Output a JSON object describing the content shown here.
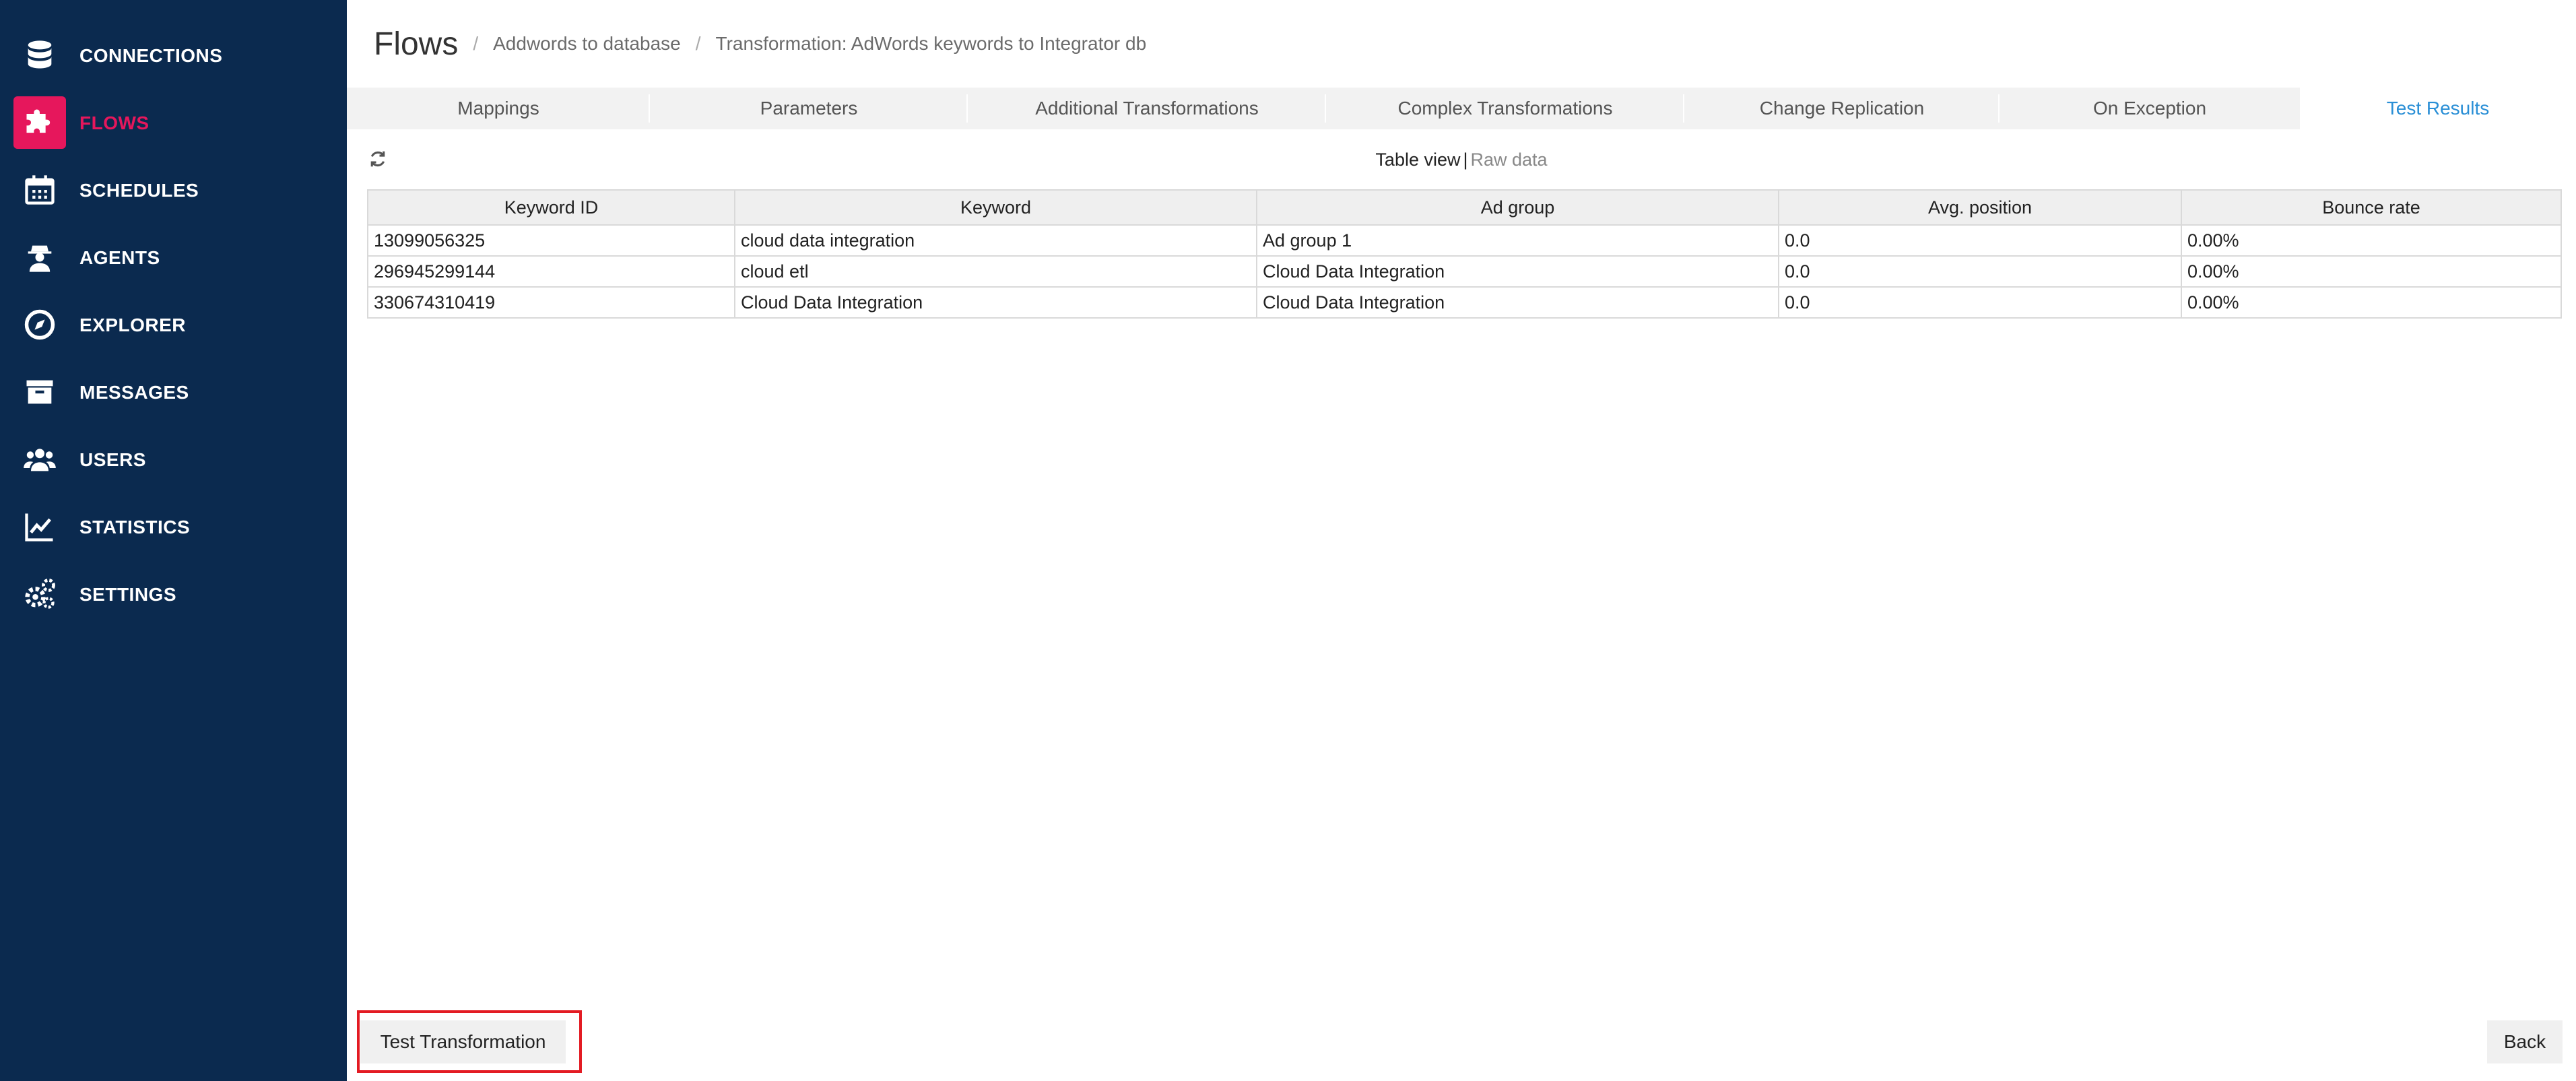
{
  "sidebar": {
    "items": [
      {
        "label": "CONNECTIONS",
        "icon": "database-icon"
      },
      {
        "label": "FLOWS",
        "icon": "puzzle-icon",
        "active": true
      },
      {
        "label": "SCHEDULES",
        "icon": "calendar-icon"
      },
      {
        "label": "AGENTS",
        "icon": "agent-icon"
      },
      {
        "label": "EXPLORER",
        "icon": "compass-icon"
      },
      {
        "label": "MESSAGES",
        "icon": "archive-icon"
      },
      {
        "label": "USERS",
        "icon": "users-icon"
      },
      {
        "label": "STATISTICS",
        "icon": "line-chart-icon"
      },
      {
        "label": "SETTINGS",
        "icon": "gears-icon"
      }
    ]
  },
  "header": {
    "title": "Flows",
    "separator": "/",
    "breadcrumbs": [
      "Addwords to database",
      "Transformation: AdWords keywords to Integrator db"
    ]
  },
  "tabs": [
    {
      "label": "Mappings"
    },
    {
      "label": "Parameters"
    },
    {
      "label": "Additional Transformations"
    },
    {
      "label": "Complex Transformations"
    },
    {
      "label": "Change Replication"
    },
    {
      "label": "On Exception"
    },
    {
      "label": "Test Results",
      "active": true
    }
  ],
  "view_toggle": {
    "table_view": "Table view",
    "separator": "|",
    "raw_data": "Raw data"
  },
  "table": {
    "columns": [
      "Keyword ID",
      "Keyword",
      "Ad group",
      "Avg. position",
      "Bounce rate"
    ],
    "rows": [
      [
        "13099056325",
        "cloud data integration",
        "Ad group 1",
        "0.0",
        "0.00%"
      ],
      [
        "296945299144",
        "cloud etl",
        "Cloud Data Integration",
        "0.0",
        "0.00%"
      ],
      [
        "330674310419",
        "Cloud Data Integration",
        "Cloud Data Integration",
        "0.0",
        "0.00%"
      ]
    ]
  },
  "buttons": {
    "test_transformation": "Test Transformation",
    "back": "Back"
  },
  "colors": {
    "sidebar_bg": "#0b2a4f",
    "accent": "#e6175c",
    "active_tab": "#2a8fd6",
    "highlight": "#e31b23"
  }
}
